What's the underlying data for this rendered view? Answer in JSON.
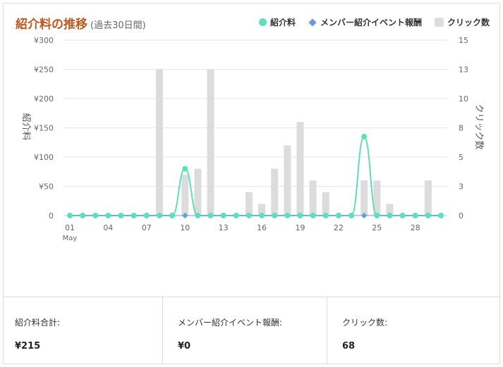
{
  "header": {
    "title": "紹介料の推移",
    "subtitle": "(過去30日間)"
  },
  "legend": {
    "items": [
      {
        "label": "紹介料",
        "color": "#5ddfb9"
      },
      {
        "label": "メンバー紹介イベント報酬",
        "color": "#6b9ad8"
      },
      {
        "label": "クリック数",
        "color": "#dddddd"
      }
    ]
  },
  "chart_data": {
    "type": "bar",
    "x": [
      "01",
      "02",
      "03",
      "04",
      "05",
      "06",
      "07",
      "08",
      "09",
      "10",
      "11",
      "12",
      "13",
      "14",
      "15",
      "16",
      "17",
      "18",
      "19",
      "20",
      "21",
      "22",
      "23",
      "24",
      "25",
      "26",
      "27",
      "28",
      "29",
      "30"
    ],
    "xticks": [
      "01",
      "04",
      "07",
      "10",
      "13",
      "16",
      "19",
      "22",
      "25",
      "28"
    ],
    "xmonth": "May",
    "ylabel_left": "紹介料",
    "ylabel_right": "クリック数",
    "y_left_ticks": [
      "0",
      "¥50",
      "¥100",
      "¥150",
      "¥200",
      "¥250",
      "¥300"
    ],
    "y_right_ticks": [
      "0",
      "3",
      "5",
      "8",
      "10",
      "13",
      "15"
    ],
    "ylim_left": [
      0,
      300
    ],
    "ylim_right": [
      0,
      15
    ],
    "series": [
      {
        "name": "クリック数",
        "type": "bar",
        "axis": "right",
        "values": [
          0,
          0,
          0,
          0,
          0,
          0,
          0,
          12.5,
          0,
          3.5,
          4,
          12.5,
          0,
          0,
          2,
          1,
          4,
          6,
          8,
          3,
          2,
          0,
          0,
          3,
          3,
          1,
          0,
          0,
          3,
          0
        ]
      },
      {
        "name": "紹介料",
        "type": "line",
        "axis": "left",
        "values": [
          0,
          0,
          0,
          0,
          0,
          0,
          0,
          0,
          0,
          80,
          0,
          0,
          0,
          0,
          0,
          0,
          0,
          0,
          0,
          0,
          0,
          0,
          0,
          135,
          0,
          0,
          0,
          0,
          0,
          0
        ]
      },
      {
        "name": "メンバー紹介イベント報酬",
        "type": "line",
        "axis": "left",
        "values": [
          0,
          0,
          0,
          0,
          0,
          0,
          0,
          0,
          0,
          0,
          0,
          0,
          0,
          0,
          0,
          0,
          0,
          0,
          0,
          0,
          0,
          0,
          0,
          0,
          0,
          0,
          0,
          0,
          0,
          0
        ]
      }
    ],
    "grid": true,
    "legend_position": "top-right"
  },
  "stats": [
    {
      "label": "紹介料合計:",
      "value": "¥215"
    },
    {
      "label": "メンバー紹介イベント報酬:",
      "value": "¥0"
    },
    {
      "label": "クリック数:",
      "value": "68"
    }
  ]
}
